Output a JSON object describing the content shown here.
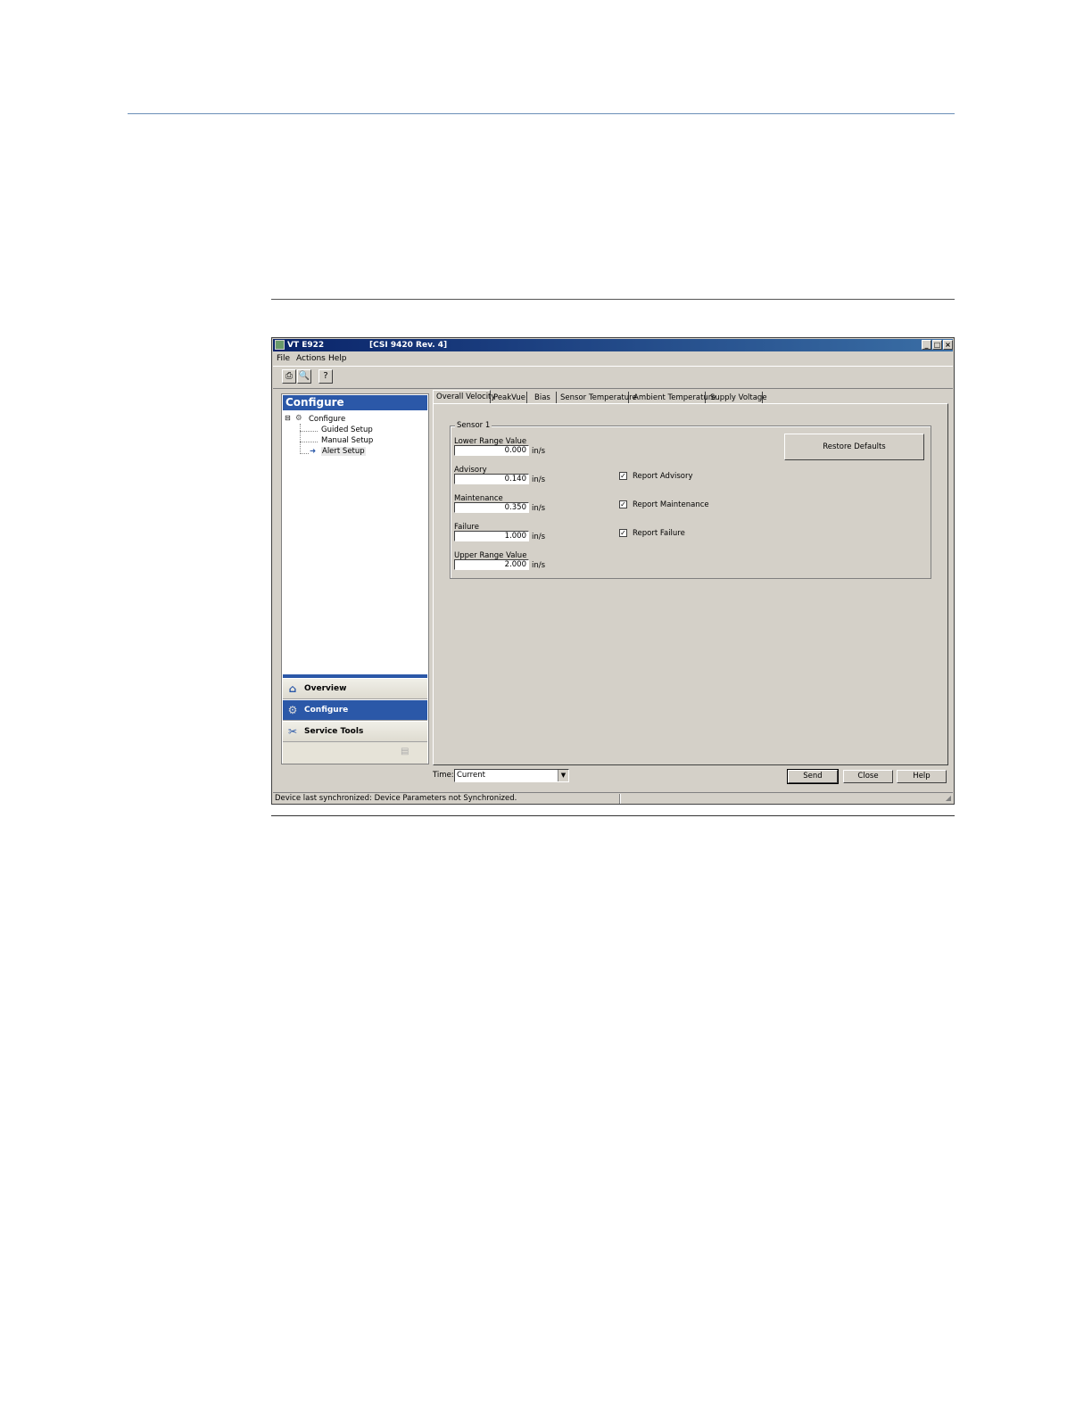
{
  "window": {
    "title": "VT E922",
    "subtitle": "[CSI 9420 Rev. 4]",
    "controls": {
      "minimize": "_",
      "maximize": "□",
      "close": "×"
    }
  },
  "menu": [
    "File",
    "Actions",
    "Help"
  ],
  "toolbar": {
    "icons": [
      "print-icon",
      "print-preview-icon",
      "context-help-icon"
    ]
  },
  "left_panel": {
    "header": "Configure",
    "tree": {
      "root": "Configure",
      "children": [
        "Guided Setup",
        "Manual Setup",
        "Alert Setup"
      ],
      "selected": "Alert Setup"
    },
    "nav": [
      {
        "label": "Overview",
        "icon": "home-icon"
      },
      {
        "label": "Configure",
        "icon": "configure-icon",
        "active": true
      },
      {
        "label": "Service Tools",
        "icon": "tools-icon"
      }
    ]
  },
  "tabs": [
    "Overall Velocity",
    "PeakVue",
    "Bias",
    "Sensor Temperature",
    "Ambient Temperature",
    "Supply Voltage"
  ],
  "active_tab": "Overall Velocity",
  "group": {
    "title": "Sensor 1",
    "fields": [
      {
        "label": "Lower Range Value",
        "value": "0.000",
        "unit": "in/s"
      },
      {
        "label": "Advisory",
        "value": "0.140",
        "unit": "in/s"
      },
      {
        "label": "Maintenance",
        "value": "0.350",
        "unit": "in/s"
      },
      {
        "label": "Failure",
        "value": "1.000",
        "unit": "in/s"
      },
      {
        "label": "Upper Range Value",
        "value": "2.000",
        "unit": "in/s"
      }
    ],
    "checkboxes": [
      {
        "label": "Report Advisory",
        "checked": true
      },
      {
        "label": "Report Maintenance",
        "checked": true
      },
      {
        "label": "Report Failure",
        "checked": true
      }
    ],
    "restore_button": "Restore Defaults"
  },
  "bottom": {
    "time_label": "Time:",
    "time_value": "Current",
    "buttons": [
      "Send",
      "Close",
      "Help"
    ]
  },
  "status": "Device last synchronized: Device Parameters not Synchronized."
}
